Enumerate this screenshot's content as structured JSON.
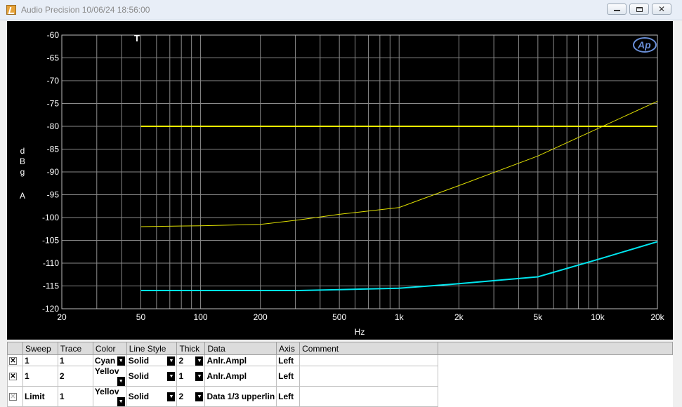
{
  "window": {
    "title": "Audio Precision   10/06/24 18:56:00",
    "minimize_label": "",
    "maximize_label": "",
    "close_label": "✕"
  },
  "graph": {
    "marker": "T",
    "ylabel_chars": [
      "d",
      "B",
      "g",
      "",
      "A"
    ],
    "xlabel": "Hz",
    "logo": "Ap"
  },
  "chart_data": {
    "type": "line",
    "x_scale": "log",
    "xlim": [
      20,
      20000
    ],
    "ylim": [
      -120,
      -60
    ],
    "xlabel": "Hz",
    "ylabel": "dBg A",
    "grid": true,
    "y_ticks": [
      -60,
      -65,
      -70,
      -75,
      -80,
      -85,
      -90,
      -95,
      -100,
      -105,
      -110,
      -115,
      -120
    ],
    "x_ticks": [
      {
        "v": 20,
        "l": "20"
      },
      {
        "v": 50,
        "l": "50"
      },
      {
        "v": 100,
        "l": "100"
      },
      {
        "v": 200,
        "l": "200"
      },
      {
        "v": 500,
        "l": "500"
      },
      {
        "v": 1000,
        "l": "1k"
      },
      {
        "v": 2000,
        "l": "2k"
      },
      {
        "v": 5000,
        "l": "5k"
      },
      {
        "v": 10000,
        "l": "10k"
      },
      {
        "v": 20000,
        "l": "20k"
      }
    ],
    "series": [
      {
        "color": "#00e5ee",
        "width": 2,
        "points": [
          [
            50,
            -116
          ],
          [
            100,
            -116
          ],
          [
            200,
            -116
          ],
          [
            315,
            -116
          ],
          [
            500,
            -115.8
          ],
          [
            1000,
            -115.5
          ],
          [
            2000,
            -114.5
          ],
          [
            5000,
            -113
          ],
          [
            10000,
            -109.2
          ],
          [
            20000,
            -105.3
          ]
        ]
      },
      {
        "color": "#e0e000",
        "width": 1,
        "points": [
          [
            50,
            -102
          ],
          [
            100,
            -101.8
          ],
          [
            200,
            -101.5
          ],
          [
            315,
            -100.5
          ],
          [
            500,
            -99.3
          ],
          [
            1000,
            -97.8
          ],
          [
            2000,
            -93
          ],
          [
            5000,
            -86.5
          ],
          [
            10000,
            -80.5
          ],
          [
            20000,
            -74.5
          ]
        ]
      },
      {
        "color": "#ffff00",
        "width": 2,
        "points": [
          [
            50,
            -80
          ],
          [
            20000,
            -80
          ]
        ]
      }
    ]
  },
  "table": {
    "headers": [
      "Sweep",
      "Trace",
      "Color",
      "Line Style",
      "Thick",
      "Data",
      "Axis",
      "Comment"
    ],
    "rows": [
      {
        "check": "✕",
        "sweep": "1",
        "trace": "1",
        "color": "Cyan",
        "style": "Solid",
        "thick": "2",
        "data": "Anlr.Ampl",
        "axis": "Left",
        "comment": ""
      },
      {
        "check": "✕",
        "sweep": "1",
        "trace": "2",
        "color": "Yellov",
        "style": "Solid",
        "thick": "1",
        "data": "Anlr.Ampl",
        "axis": "Left",
        "comment": ""
      },
      {
        "check": "✕",
        "sweep": "Limit",
        "trace": "1",
        "color": "Yellov",
        "style": "Solid",
        "thick": "2",
        "data": "Data 1/3 upperlin",
        "axis": "Left",
        "comment": ""
      }
    ]
  }
}
